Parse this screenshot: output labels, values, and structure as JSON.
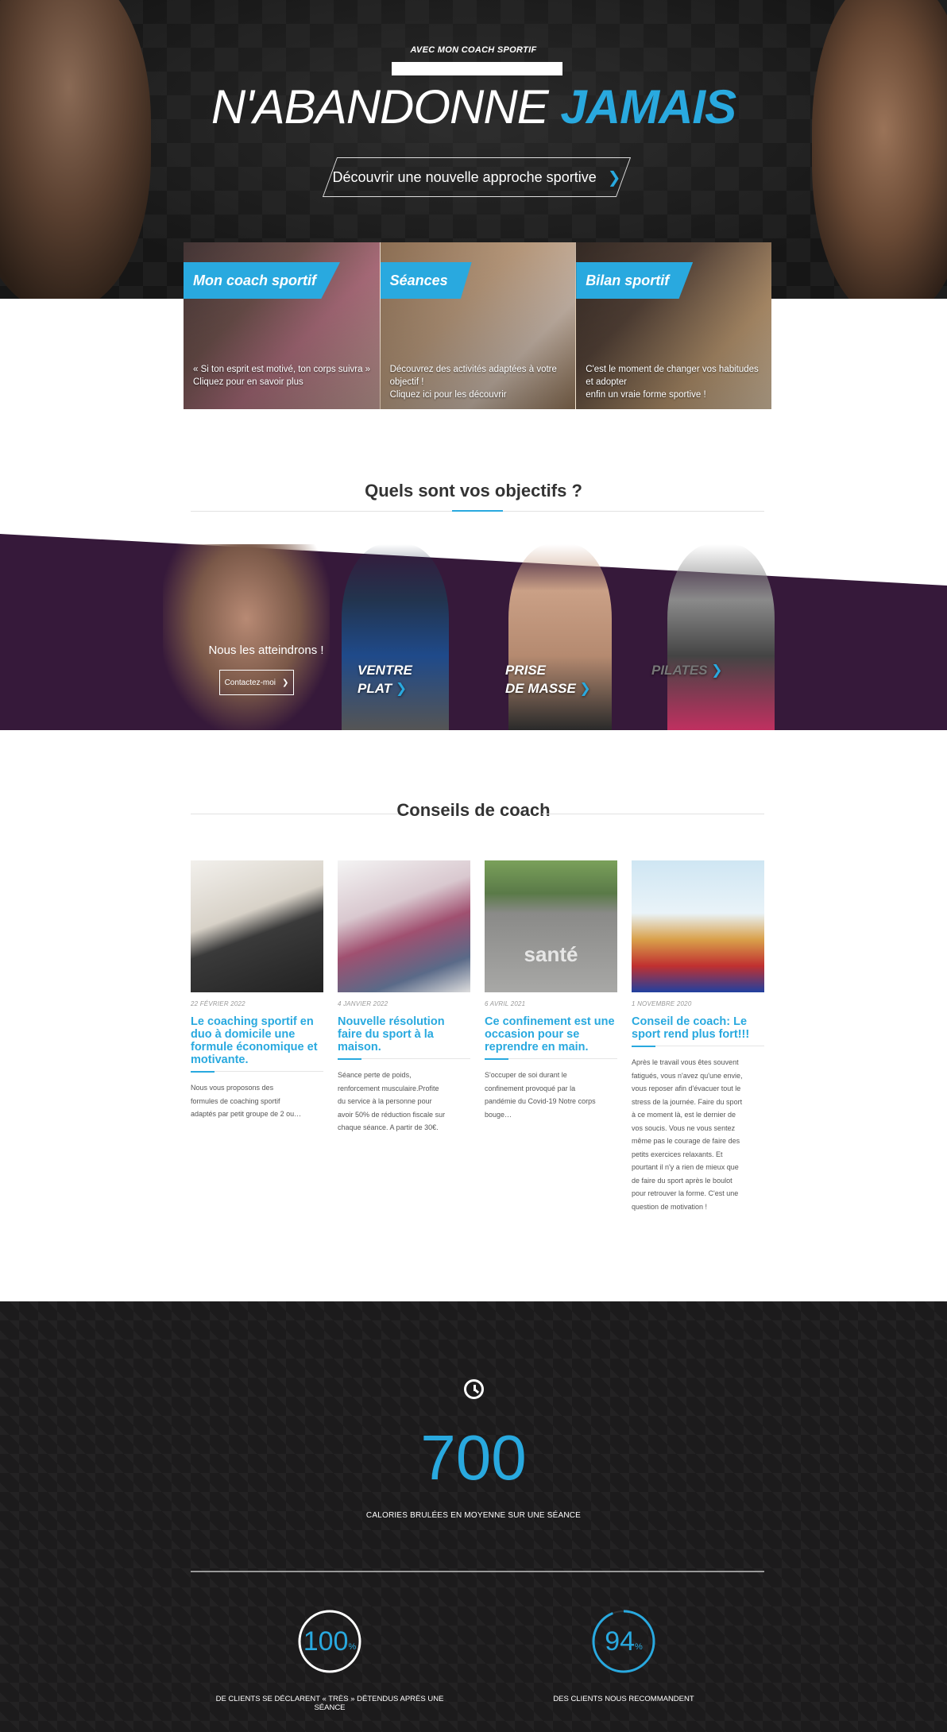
{
  "hero": {
    "kicker": "AVEC MON COACH SPORTIF",
    "title_part1": "N'ABANDONNE",
    "title_part2": "JAMAIS",
    "cta_label": "Découvrir une nouvelle approche sportive",
    "cta_icon": "chevron-right-icon"
  },
  "feature_cards": [
    {
      "label": "Mon coach sportif",
      "text_line1": "« Si ton esprit est motivé, ton corps suivra »",
      "text_line2": "Cliquez pour en savoir plus"
    },
    {
      "label": "Séances",
      "text_line1": "Découvrez des activités adaptées à votre objectif !",
      "text_line2": "Cliquez ici pour les découvrir"
    },
    {
      "label": "Bilan sportif",
      "text_line1": "C'est le moment de changer vos habitudes et adopter",
      "text_line2": "enfin un vraie forme sportive !"
    }
  ],
  "objectives": {
    "title": "Quels sont vos objectifs ?",
    "reach_text": "Nous les atteindrons !",
    "contact_label": "Contactez-moi",
    "items": [
      {
        "line1": "VENTRE",
        "line2": "PLAT"
      },
      {
        "line1": "PRISE",
        "line2": "DE MASSE"
      },
      {
        "line1": "PILATES",
        "line2": ""
      }
    ]
  },
  "blog": {
    "title": "Conseils de coach",
    "posts": [
      {
        "date": "22 FÉVRIER 2022",
        "title": "Le coaching sportif en duo à domicile une formule économique et motivante.",
        "excerpt": "Nous vous proposons des formules de coaching sportif adaptés par petit groupe de 2 ou…"
      },
      {
        "date": "4 JANVIER 2022",
        "title": "Nouvelle résolution faire du sport à la maison.",
        "excerpt": "Séance perte de poids, renforcement musculaire.Profite du service à la personne pour avoir 50% de réduction fiscale sur chaque séance. A partir de 30€."
      },
      {
        "date": "6 AVRIL 2021",
        "title": "Ce confinement est une occasion pour se reprendre en main.",
        "excerpt": "S'occuper de soi durant le confinement provoqué par la pandémie du Covid-19 Notre corps bouge…",
        "image_text": "santé"
      },
      {
        "date": "1 NOVEMBRE 2020",
        "title": "Conseil de coach: Le sport rend plus fort!!!",
        "excerpt": "Après le travail vous êtes souvent fatigués, vous n'avez qu'une envie, vous reposer afin d'évacuer tout le stress de la journée. Faire du sport à ce moment là, est le dernier de vos soucis. Vous ne vous sentez même pas le courage de faire des petits exercices relaxants. Et pourtant il n'y a rien de mieux que de faire du sport après le boulot pour retrouver la forme. C'est une question de motivation !"
      }
    ]
  },
  "stats": {
    "icon": "clock-icon",
    "calories_value": "700",
    "calories_caption": "CALORIES BRULÉES EN MOYENNE SUR UNE SÉANCE",
    "rings": [
      {
        "value": "100",
        "unit": "%",
        "fraction": 1.0,
        "caption": "DE CLIENTS SE DÉCLARENT « TRÈS » DÉTENDUS APRÈS UNE SÉANCE"
      },
      {
        "value": "94",
        "unit": "%",
        "fraction": 0.94,
        "caption": "DES CLIENTS NOUS RECOMMANDENT"
      }
    ]
  },
  "colors": {
    "accent": "#29a9df",
    "band": "#36193a",
    "dark": "#1c1b1c"
  }
}
